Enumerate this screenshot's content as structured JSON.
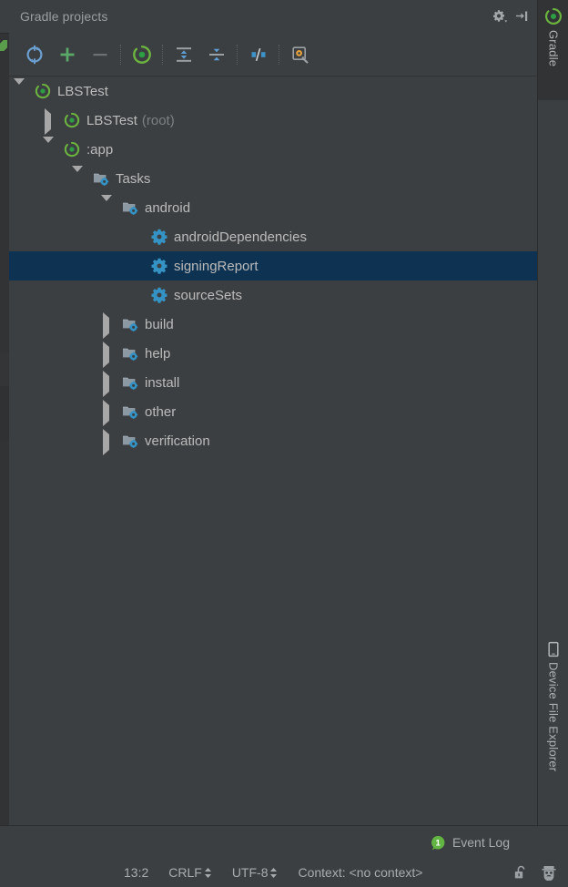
{
  "window": {
    "panel_title": "Gradle projects"
  },
  "header_actions": [
    {
      "name": "settings-gear-dropdown",
      "icon": "gear-dropdown-icon",
      "label": "Settings"
    },
    {
      "name": "hide-panel",
      "icon": "hide-icon",
      "label": "Hide"
    }
  ],
  "toolbar": {
    "buttons": [
      {
        "name": "refresh-all-gradle-projects",
        "icon": "refresh-icon",
        "label": "Refresh all Gradle projects"
      },
      {
        "name": "link-gradle-project",
        "icon": "plus-icon",
        "label": "Link Gradle Project"
      },
      {
        "name": "unlink-gradle-project",
        "icon": "minus-icon",
        "label": "Unlink Gradle Project"
      },
      {
        "name": "execute-gradle-task",
        "icon": "gradle-run-icon",
        "label": "Execute Gradle Task"
      },
      {
        "name": "expand-all",
        "icon": "expand-all-icon",
        "label": "Expand All"
      },
      {
        "name": "collapse-all",
        "icon": "collapse-all-icon",
        "label": "Collapse All"
      },
      {
        "name": "toggle-offline-mode",
        "icon": "offline-mode-icon",
        "label": "Toggle Offline Mode"
      },
      {
        "name": "gradle-settings",
        "icon": "gradle-settings-icon",
        "label": "Gradle Settings"
      }
    ]
  },
  "tree": {
    "rows": [
      {
        "label": "LBSTest",
        "suffix": "",
        "depth": 0,
        "toggle": "down",
        "icon": "gradle-icon",
        "selected": false
      },
      {
        "label": "LBSTest",
        "suffix": "(root)",
        "depth": 1,
        "toggle": "right",
        "icon": "gradle-icon",
        "selected": false
      },
      {
        "label": ":app",
        "suffix": "",
        "depth": 1,
        "toggle": "down",
        "icon": "gradle-icon",
        "selected": false
      },
      {
        "label": "Tasks",
        "suffix": "",
        "depth": 2,
        "toggle": "down",
        "icon": "task-folder-icon",
        "selected": false
      },
      {
        "label": "android",
        "suffix": "",
        "depth": 3,
        "toggle": "down",
        "icon": "task-folder-icon",
        "selected": false
      },
      {
        "label": "androidDependencies",
        "suffix": "",
        "depth": 4,
        "toggle": "none",
        "icon": "gear-task-icon",
        "selected": false
      },
      {
        "label": "signingReport",
        "suffix": "",
        "depth": 4,
        "toggle": "none",
        "icon": "gear-task-icon",
        "selected": true
      },
      {
        "label": "sourceSets",
        "suffix": "",
        "depth": 4,
        "toggle": "none",
        "icon": "gear-task-icon",
        "selected": false
      },
      {
        "label": "build",
        "suffix": "",
        "depth": 3,
        "toggle": "right",
        "icon": "task-folder-icon",
        "selected": false
      },
      {
        "label": "help",
        "suffix": "",
        "depth": 3,
        "toggle": "right",
        "icon": "task-folder-icon",
        "selected": false
      },
      {
        "label": "install",
        "suffix": "",
        "depth": 3,
        "toggle": "right",
        "icon": "task-folder-icon",
        "selected": false
      },
      {
        "label": "other",
        "suffix": "",
        "depth": 3,
        "toggle": "right",
        "icon": "task-folder-icon",
        "selected": false
      },
      {
        "label": "verification",
        "suffix": "",
        "depth": 3,
        "toggle": "right",
        "icon": "task-folder-icon",
        "selected": false
      }
    ]
  },
  "right_strip": {
    "tabs": [
      {
        "name": "tool-window-gradle",
        "label": "Gradle",
        "icon": "gradle-icon"
      },
      {
        "name": "tool-window-device-file-explorer",
        "label": "Device File Explorer",
        "icon": "device-icon"
      }
    ]
  },
  "event_log": {
    "label": "Event Log",
    "count": "1"
  },
  "status_bar": {
    "caret_position": "13:2",
    "line_separator": "CRLF",
    "encoding": "UTF-8",
    "context": "Context: <no context>",
    "lock_label": "Toggle read-only attribute",
    "inspector_label": "Hector the inspector"
  },
  "colors": {
    "panel_bg": "#3c3f41",
    "selection_bg": "#0d3252",
    "gradle_green": "#6cb33f",
    "task_blue": "#3592c4",
    "text": "#bbbbbb",
    "muted_text": "#7d8082",
    "badge_green": "#62b543"
  }
}
